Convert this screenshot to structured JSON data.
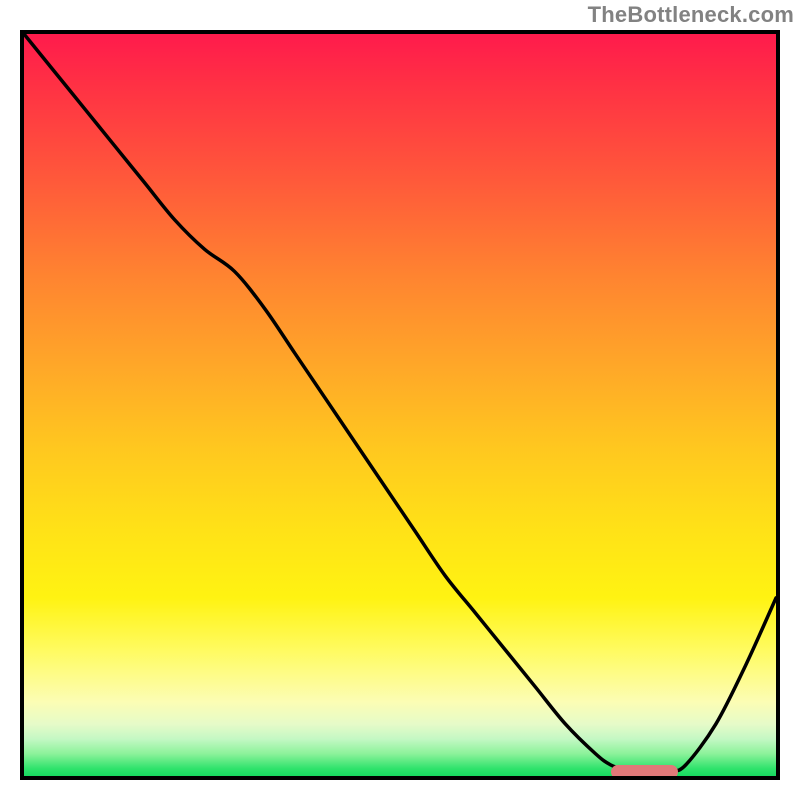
{
  "attribution": "TheBottleneck.com",
  "colors": {
    "border": "#000000",
    "curve": "#000000",
    "marker": "#e17979",
    "attribution": "#828282",
    "gradient_stops": [
      "#ff1b4c",
      "#ff3144",
      "#ff5a3a",
      "#ff8530",
      "#ffa828",
      "#ffc81f",
      "#ffe217",
      "#fff312",
      "#fffb60",
      "#fcfdb4",
      "#e6fbc8",
      "#c4f8c4",
      "#8cf29a",
      "#2fe36c",
      "#17da60"
    ]
  },
  "chart_data": {
    "type": "line",
    "title": "",
    "xlabel": "",
    "ylabel": "",
    "xlim": [
      0,
      100
    ],
    "ylim": [
      0,
      100
    ],
    "grid": false,
    "legend": false,
    "x": [
      0,
      4,
      8,
      12,
      16,
      20,
      24,
      28,
      32,
      36,
      40,
      44,
      48,
      52,
      56,
      60,
      64,
      68,
      72,
      76,
      78,
      80,
      82,
      84,
      86,
      88,
      92,
      96,
      100
    ],
    "values": [
      100,
      95,
      90,
      85,
      80,
      75,
      71,
      68,
      63,
      57,
      51,
      45,
      39,
      33,
      27,
      22,
      17,
      12,
      7,
      3,
      1.5,
      0.8,
      0.5,
      0.5,
      0.6,
      1.5,
      7,
      15,
      24
    ],
    "marker": {
      "x_start": 78,
      "x_end": 87,
      "y": 0.5
    },
    "note": "x/y in 0–100 normalized units; y reads upward. Values estimated from pixels."
  }
}
